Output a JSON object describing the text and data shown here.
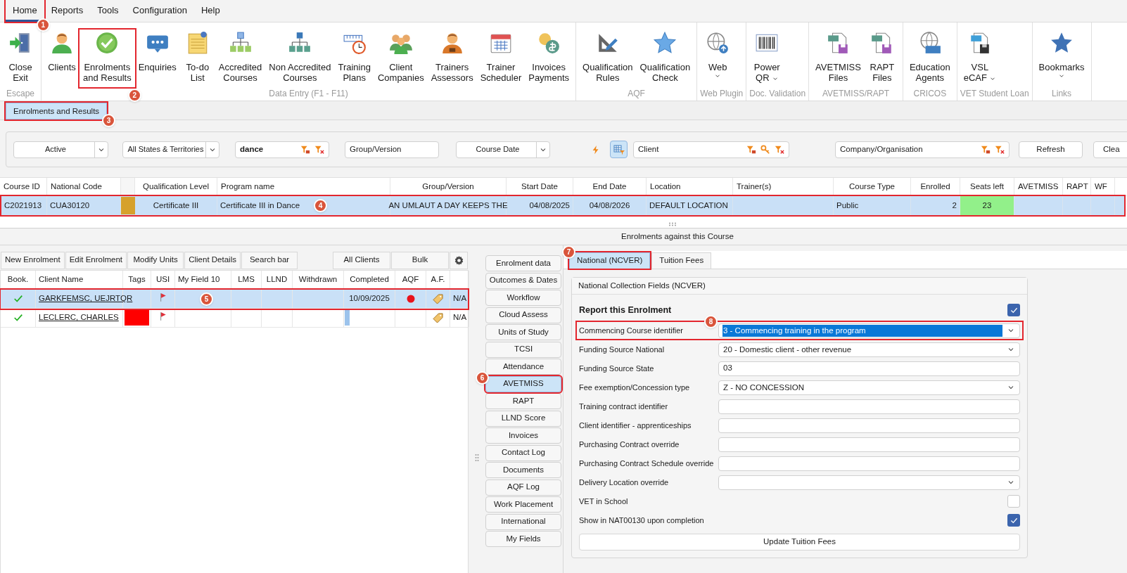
{
  "menu": [
    {
      "label": "Home",
      "selected": true,
      "callout": "1"
    },
    {
      "label": "Reports",
      "selected": false
    },
    {
      "label": "Tools",
      "selected": false
    },
    {
      "label": "Configuration",
      "selected": false
    },
    {
      "label": "Help",
      "selected": false
    }
  ],
  "ribbon": [
    {
      "label": "Escape",
      "buttons": [
        {
          "label": "Close\nExit"
        }
      ]
    },
    {
      "label": "Data Entry (F1 - F11)",
      "buttons": [
        {
          "label": "Clients"
        },
        {
          "label": "Enrolments\nand Results",
          "callout": "2"
        },
        {
          "label": "Enquiries"
        },
        {
          "label": "To-do\nList"
        },
        {
          "label": "Accredited\nCourses"
        },
        {
          "label": "Non Accredited\nCourses"
        },
        {
          "label": "Training\nPlans"
        },
        {
          "label": "Client\nCompanies"
        },
        {
          "label": "Trainers\nAssessors"
        },
        {
          "label": "Trainer\nScheduler"
        },
        {
          "label": "Invoices\nPayments"
        }
      ]
    },
    {
      "label": "AQF",
      "buttons": [
        {
          "label": "Qualification\nRules"
        },
        {
          "label": "Qualification\nCheck"
        }
      ]
    },
    {
      "label": "Web Plugin",
      "buttons": [
        {
          "label": "Web",
          "dropdown": true
        }
      ]
    },
    {
      "label": "Doc. Validation",
      "buttons": [
        {
          "label": "Power\nQR",
          "dropdown": true
        }
      ]
    },
    {
      "label": "AVETMISS/RAPT",
      "buttons": [
        {
          "label": "AVETMISS\nFiles"
        },
        {
          "label": "RAPT\nFiles"
        }
      ]
    },
    {
      "label": "CRICOS",
      "buttons": [
        {
          "label": "Education\nAgents"
        }
      ]
    },
    {
      "label": "VET Student Loan",
      "buttons": [
        {
          "label": "VSL\neCAF",
          "dropdown": true
        }
      ]
    },
    {
      "label": "Links",
      "buttons": [
        {
          "label": "Bookmarks",
          "dropdown": true
        }
      ]
    }
  ],
  "document_tabs": [
    {
      "label": "Enrolments and Results",
      "selected": true,
      "callout": "3"
    }
  ],
  "filters": [
    {
      "kind": "dropdown",
      "value": "Active"
    },
    {
      "kind": "dropdown",
      "value": "All States & Territories"
    },
    {
      "kind": "search",
      "value": "dance"
    },
    {
      "kind": "field",
      "placeholder": "Group/Version"
    },
    {
      "kind": "dropdown",
      "value": "Course Date"
    },
    {
      "kind": "icon_button",
      "selected": false
    },
    {
      "kind": "icon_button",
      "selected": true
    },
    {
      "kind": "lookup",
      "placeholder": "Client",
      "key": true
    },
    {
      "kind": "lookup",
      "placeholder": "Company/Organisation",
      "key": false
    },
    {
      "kind": "button",
      "label": "Refresh"
    },
    {
      "kind": "button",
      "label": "Clea"
    }
  ],
  "course_table": {
    "columns": [
      {
        "label": "Course ID"
      },
      {
        "label": "National Code"
      },
      {
        "kind": "swatch"
      },
      {
        "label": "Qualification Level"
      },
      {
        "label": "Program name"
      },
      {
        "label": "Group/Version"
      },
      {
        "label": "Start Date"
      },
      {
        "label": "End Date"
      },
      {
        "label": "Location"
      },
      {
        "label": "Trainer(s)"
      },
      {
        "label": "Course Type"
      },
      {
        "label": "Enrolled"
      },
      {
        "label": "Seats left"
      },
      {
        "label": "AVETMISS"
      },
      {
        "label": "RAPT"
      },
      {
        "label": "WF"
      }
    ],
    "rows": [
      {
        "selected": true,
        "callout": "4",
        "cells": [
          {
            "text": "C2021913"
          },
          {
            "text": "CUA30120"
          },
          {
            "color": "#d6a12c"
          },
          {
            "text": "Certificate III"
          },
          {
            "text": "Certificate III in Dance"
          },
          {
            "text": "AN UMLAUT A DAY KEEPS THE"
          },
          {
            "text": "04/08/2025"
          },
          {
            "text": "04/08/2026"
          },
          {
            "text": "DEFAULT LOCATION"
          },
          {},
          {
            "text": "Public"
          },
          {
            "text": "2"
          },
          {
            "text": "23",
            "highlight": true
          },
          {},
          {},
          {}
        ]
      }
    ]
  },
  "section_title": "Enrolments against this Course",
  "enrolment_toolbar": {
    "left": [
      "New Enrolment",
      "Edit Enrolment",
      "Modify Units",
      "Client Details",
      "Search bar"
    ],
    "right": [
      "All Clients",
      "Bulk"
    ]
  },
  "enrolment_table": {
    "columns": [
      {
        "label": "Book."
      },
      {
        "label": "Client Name"
      },
      {
        "label": "Tags"
      },
      {
        "label": "USI"
      },
      {
        "label": "My Field 10"
      },
      {
        "label": "LMS"
      },
      {
        "label": "LLND"
      },
      {
        "label": "Withdrawn"
      },
      {
        "label": "Completed"
      },
      {
        "label": "AQF"
      },
      {
        "label": "A.F."
      },
      {}
    ],
    "rows": [
      {
        "selected": true,
        "callout": "5",
        "cells": [
          {
            "checked": true
          },
          {
            "text": "GARKFEMSC, UEJRTQR",
            "link": true
          },
          {},
          {
            "flag": true
          },
          {},
          {},
          {},
          {},
          {
            "text": "10/09/2025"
          },
          {
            "dot": true
          },
          {
            "tag": true
          },
          {
            "text": "N/A"
          }
        ]
      },
      {
        "selected": false,
        "cells": [
          {
            "checked": true
          },
          {
            "text": "LECLERC, CHARLES",
            "link": true
          },
          {
            "color": "#ff0000"
          },
          {
            "flag": true
          },
          {},
          {},
          {},
          {},
          {
            "level": 0.1
          },
          {},
          {
            "tag": true
          },
          {
            "text": "N/A"
          }
        ]
      }
    ]
  },
  "side_tabs": [
    {
      "label": "Enrolment data",
      "selected": false
    },
    {
      "label": "Outcomes & Dates",
      "selected": false
    },
    {
      "label": "Workflow",
      "selected": false
    },
    {
      "label": "Cloud Assess",
      "selected": false
    },
    {
      "label": "Units of Study",
      "selected": false
    },
    {
      "label": "TCSI",
      "selected": false
    },
    {
      "label": "Attendance",
      "selected": false
    },
    {
      "label": "AVETMISS",
      "selected": true,
      "callout": "6"
    },
    {
      "label": "RAPT",
      "selected": false
    },
    {
      "label": "LLND Score",
      "selected": false
    },
    {
      "label": "Invoices",
      "selected": false
    },
    {
      "label": "Contact Log",
      "selected": false
    },
    {
      "label": "Documents",
      "selected": false
    },
    {
      "label": "AQF Log",
      "selected": false
    },
    {
      "label": "Work Placement",
      "selected": false
    },
    {
      "label": "International",
      "selected": false
    },
    {
      "label": "My Fields",
      "selected": false
    }
  ],
  "detail_tabs": [
    {
      "label": "National (NCVER)",
      "selected": true,
      "callout": "7"
    },
    {
      "label": "Tuition Fees",
      "selected": false
    }
  ],
  "form": {
    "title": "National Collection Fields (NCVER)",
    "rows": [
      {
        "kind": "heading",
        "label": "Report this Enrolment",
        "checked": true
      },
      {
        "kind": "select",
        "label": "Commencing Course identifier",
        "value": "3 - Commencing training in the program",
        "focused": true,
        "callout": "8"
      },
      {
        "kind": "select",
        "label": "Funding Source National",
        "value": "20 - Domestic client - other revenue",
        "focused": false
      },
      {
        "kind": "text",
        "label": "Funding Source State",
        "value": "03"
      },
      {
        "kind": "select",
        "label": "Fee exemption/Concession type",
        "value": "Z - NO CONCESSION",
        "focused": false
      },
      {
        "kind": "text",
        "label": "Training contract identifier"
      },
      {
        "kind": "text",
        "label": "Client identifier - apprenticeships"
      },
      {
        "kind": "text",
        "label": "Purchasing Contract override"
      },
      {
        "kind": "text",
        "label": "Purchasing Contract Schedule override"
      },
      {
        "kind": "select",
        "label": "Delivery Location override",
        "focused": false
      },
      {
        "kind": "check",
        "label": "VET in School",
        "checked": false
      },
      {
        "kind": "check",
        "label": "Show in NAT00130 upon completion",
        "checked": true
      }
    ],
    "button": "Update Tuition Fees"
  }
}
